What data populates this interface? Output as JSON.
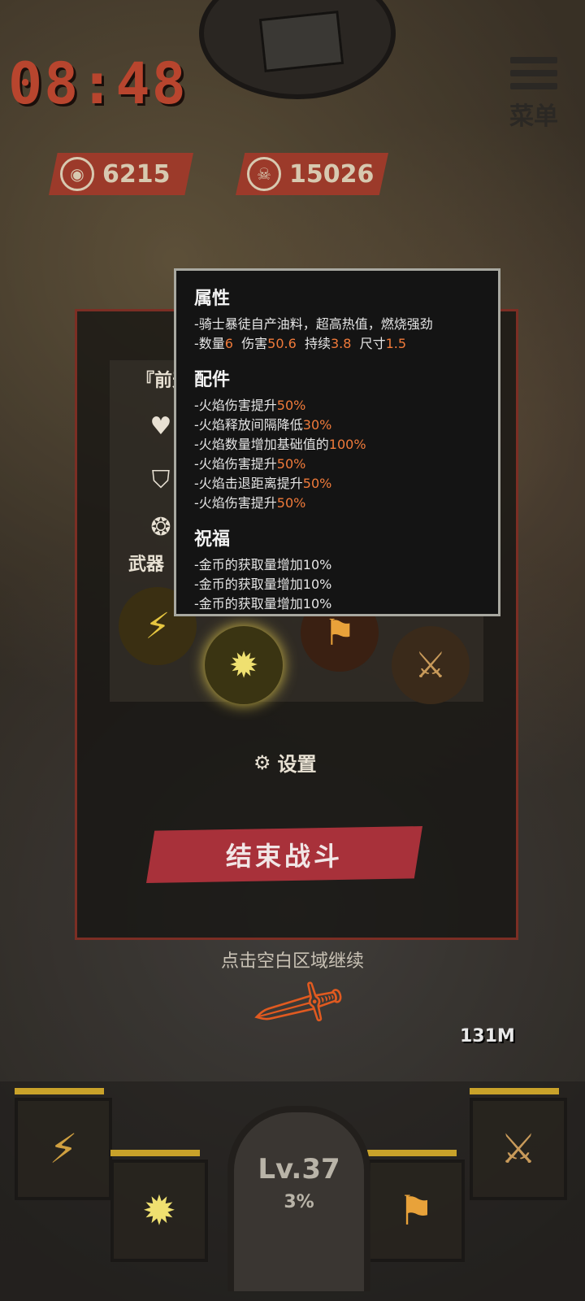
{
  "hud": {
    "timer": "08:48",
    "menu_label": "菜单",
    "coins": "6215",
    "kills": "15026"
  },
  "panel": {
    "side_title": "『前天",
    "weapons_label": "武器",
    "settings_label": "设置",
    "end_battle_label": "结束战斗",
    "continue_hint": "点击空白区域继续"
  },
  "popup": {
    "attributes": {
      "title": "属性",
      "description": "-骑士暴徒自产油料，超高热值，燃烧强劲",
      "stats": {
        "count_label": "-数量",
        "count": "6",
        "damage_label": "伤害",
        "damage": "50.6",
        "duration_label": "持续",
        "duration": "3.8",
        "size_label": "尺寸",
        "size": "1.5"
      }
    },
    "parts": {
      "title": "配件",
      "items": [
        {
          "text": "-火焰伤害提升",
          "value": "50%"
        },
        {
          "text": "-火焰释放间隔降低",
          "value": "30%"
        },
        {
          "text": "-火焰数量增加基础值的",
          "value": "100%"
        },
        {
          "text": "-火焰伤害提升",
          "value": "50%"
        },
        {
          "text": "-火焰击退距离提升",
          "value": "50%"
        },
        {
          "text": "-火焰伤害提升",
          "value": "50%"
        }
      ]
    },
    "blessings": {
      "title": "祝福",
      "items": [
        "-金币的获取量增加10%",
        "-金币的获取量增加10%",
        "-金币的获取量增加10%"
      ]
    }
  },
  "bottom": {
    "level": "Lv.37",
    "level_percent": "3%",
    "damage_badge": "131M"
  },
  "colors": {
    "highlight": "#f07a3a",
    "end_button": "#a8313a",
    "timer": "#b8452e"
  }
}
